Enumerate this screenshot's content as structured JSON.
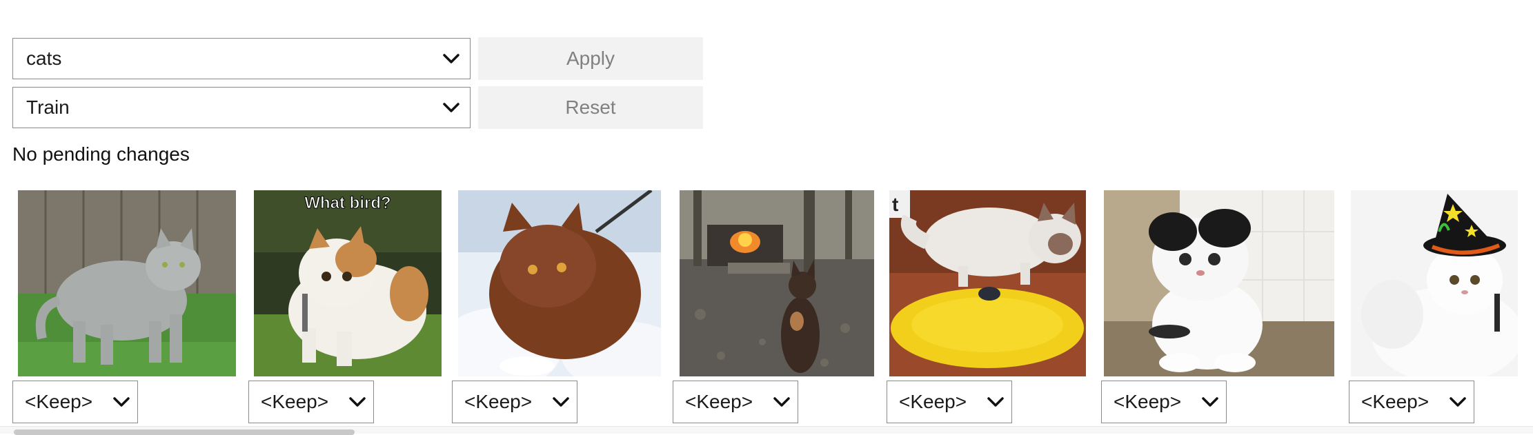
{
  "filters": {
    "category": {
      "value": "cats",
      "icon": "chevron-down-icon"
    },
    "split": {
      "value": "Train",
      "icon": "chevron-down-icon"
    }
  },
  "actions": {
    "apply_label": "Apply",
    "reset_label": "Reset"
  },
  "status": "No pending changes",
  "gallery": {
    "items": [
      {
        "image_text": "",
        "action": "<Keep>"
      },
      {
        "image_text": "What bird?",
        "action": "<Keep>"
      },
      {
        "image_text": "",
        "action": "<Keep>"
      },
      {
        "image_text": "",
        "action": "<Keep>"
      },
      {
        "image_text": "",
        "action": "<Keep>"
      },
      {
        "image_text": "",
        "action": "<Keep>"
      },
      {
        "image_text": "",
        "action": "<Keep>"
      }
    ]
  },
  "colors": {
    "button_bg": "#f2f2f2",
    "button_text": "#808080",
    "border": "#8a8a8a"
  }
}
